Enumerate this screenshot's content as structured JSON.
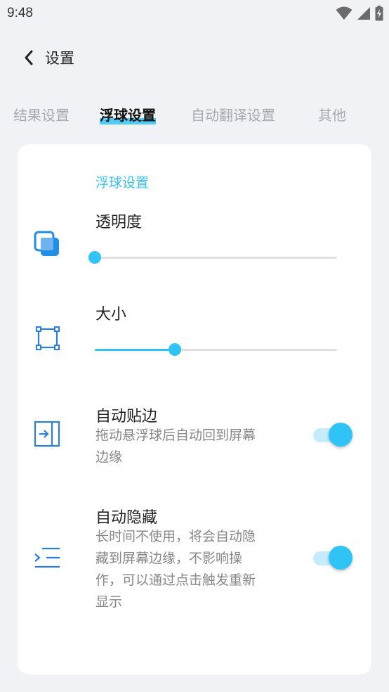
{
  "status_bar": {
    "time": "9:48",
    "icons": [
      "wifi-icon",
      "signal-icon",
      "battery-charging-icon"
    ]
  },
  "header": {
    "title": "设置",
    "back_icon": "chevron-left-icon"
  },
  "tabs": [
    {
      "label": "结果设置",
      "active": false
    },
    {
      "label": "浮球设置",
      "active": true
    },
    {
      "label": "自动翻译设置",
      "active": false
    },
    {
      "label": "其他",
      "active": false
    }
  ],
  "card": {
    "section_title": "浮球设置",
    "opacity": {
      "label": "透明度",
      "icon": "layers-icon",
      "value": 0.0
    },
    "size": {
      "label": "大小",
      "icon": "resize-frame-icon",
      "value": 0.33
    },
    "auto_snap": {
      "label": "自动贴边",
      "desc_lines": [
        "拖动悬浮球后自动回到屏幕",
        "边缘"
      ],
      "icon": "snap-to-edge-icon",
      "enabled": true
    },
    "auto_hide": {
      "label": "自动隐藏",
      "desc_lines": [
        "长时间不使用，将会自动隐",
        "藏到屏幕边缘，不影响操",
        "作，可以通过点击触发重新",
        "显示"
      ],
      "icon": "collapse-menu-icon",
      "enabled": true
    }
  },
  "colors": {
    "accent": "#30c3f6",
    "icon_blue": "#1f8fe6",
    "background": "#f1f2f6"
  }
}
